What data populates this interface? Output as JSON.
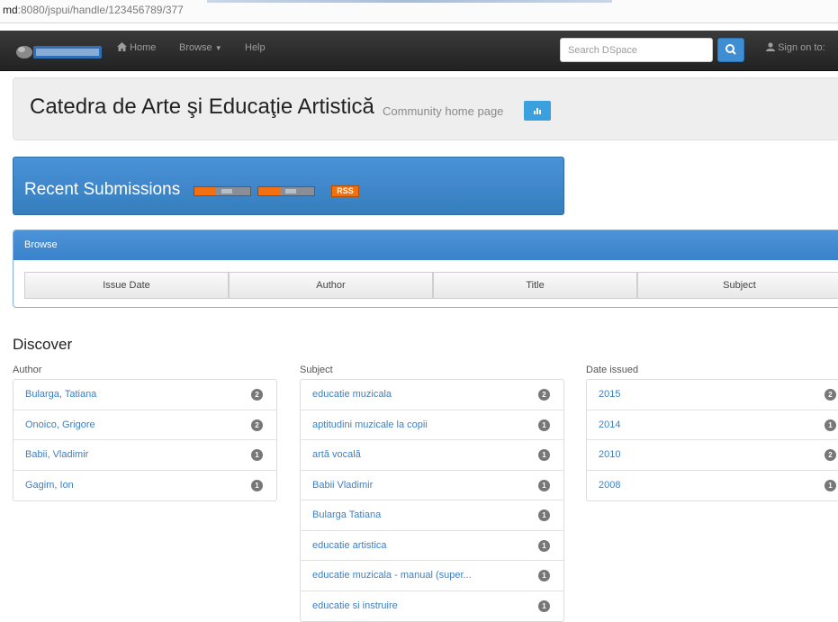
{
  "browser": {
    "url_host": "md",
    "url_path": ":8080/jspui/handle/123456789/377"
  },
  "navbar": {
    "brand_alt": "DSpace logo",
    "home": "Home",
    "browse": "Browse",
    "help": "Help",
    "search_placeholder": "Search DSpace",
    "sign_on": "Sign on to:"
  },
  "header": {
    "title": "Catedra de Arte şi Educaţie Artistică",
    "subtitle": "Community home page"
  },
  "recent": {
    "title": "Recent Submissions",
    "rss_label": "RSS"
  },
  "browse": {
    "heading": "Browse",
    "buttons": [
      "Issue Date",
      "Author",
      "Title",
      "Subject"
    ]
  },
  "discover": {
    "heading": "Discover",
    "author": {
      "label": "Author",
      "items": [
        {
          "name": "Bularga, Tatiana",
          "count": "2"
        },
        {
          "name": "Onoico, Grigore",
          "count": "2"
        },
        {
          "name": "Babii, Vladimir",
          "count": "1"
        },
        {
          "name": "Gagim, Ion",
          "count": "1"
        }
      ]
    },
    "subject": {
      "label": "Subject",
      "items": [
        {
          "name": "educatie muzicala",
          "count": "2"
        },
        {
          "name": "aptitudini muzicale la copii",
          "count": "1"
        },
        {
          "name": "artă vocală",
          "count": "1"
        },
        {
          "name": "Babii Vladimir",
          "count": "1"
        },
        {
          "name": "Bularga Tatiana",
          "count": "1"
        },
        {
          "name": "educatie artistica",
          "count": "1"
        },
        {
          "name": "educatie muzicala - manual (super...",
          "count": "1"
        },
        {
          "name": "educatie si instruire",
          "count": "1"
        }
      ]
    },
    "date": {
      "label": "Date issued",
      "items": [
        {
          "name": "2015",
          "count": "2"
        },
        {
          "name": "2014",
          "count": "1"
        },
        {
          "name": "2010",
          "count": "2"
        },
        {
          "name": "2008",
          "count": "1"
        }
      ]
    }
  },
  "colors": {
    "navbar": "#222222",
    "primary": "#428bca",
    "link": "#3d7fc1",
    "badge": "#777777",
    "rss": "#f26f12"
  }
}
